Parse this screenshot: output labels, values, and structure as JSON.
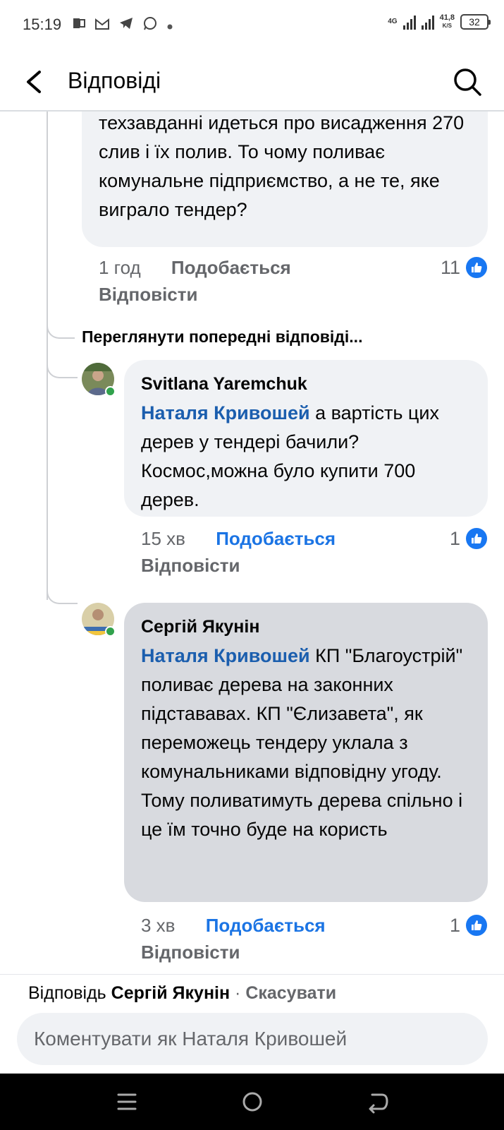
{
  "status_bar": {
    "time": "15:19",
    "left_icons": [
      "office-icon",
      "gmail-icon",
      "telegram-icon",
      "whatsapp-icon",
      "dot-icon"
    ],
    "network_type": "4G",
    "net_speed": "41,8",
    "net_speed_unit": "K/S",
    "battery": "32"
  },
  "header": {
    "title": "Відповіді"
  },
  "thread": {
    "parent": {
      "text": "техзавданні идеться про висадження 270 слив і їх полив. То чому поливає комунальне підприємство, а не те, яке виграло тендер?",
      "time": "1 год",
      "like_label": "Подобається",
      "reply_label": "Відповісти",
      "like_count": "11"
    },
    "view_previous": "Переглянути попередні відповіді...",
    "replies": [
      {
        "author": "Svitlana Yaremchuk",
        "mention": "Наталя Кривошей",
        "text": " а вартість цих дерев у тендері бачили? Космос,можна було купити 700 дерев.",
        "time": "15 хв",
        "like_label": "Подобається",
        "reply_label": "Відповісти",
        "like_count": "1"
      },
      {
        "author": "Сергій Якунін",
        "mention": "Наталя Кривошей",
        "text": " КП \"Благоустрій\" поливає дерева на законних підстававах. КП \"Єлизавета\", як переможець тендеру уклала з комунальниками відповідну угоду. Тому поливатимуть дерева спільно і це їм точно буде на користь",
        "time": "3 хв",
        "like_label": "Подобається",
        "reply_label": "Відповісти",
        "like_count": "1"
      }
    ]
  },
  "reply_bar": {
    "replying_label": "Відповідь",
    "replying_to": "Сергій Якунін",
    "separator": " · ",
    "cancel": "Скасувати",
    "placeholder": "Коментувати як Наталя Кривошей"
  },
  "colors": {
    "link_blue": "#1b74e4",
    "mention_blue": "#1b5eae",
    "bubble_bg": "#f0f2f5",
    "selected_bubble_bg": "#d8dadf",
    "meta_gray": "#65676b"
  }
}
